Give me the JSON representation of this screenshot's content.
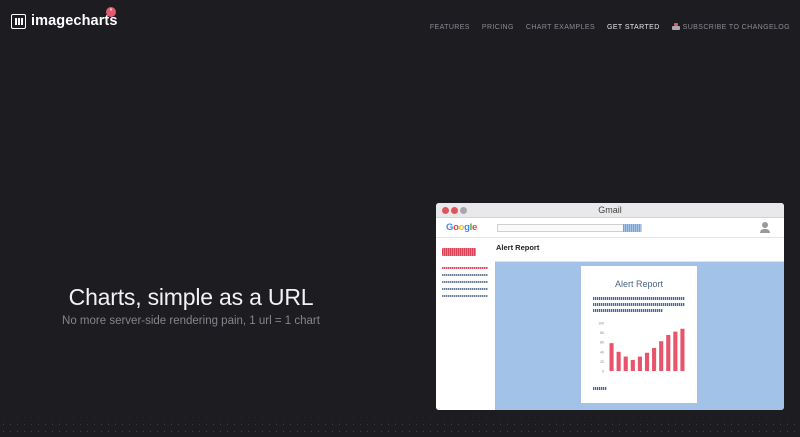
{
  "brand": {
    "name": "imagecharts",
    "badge": "*"
  },
  "nav": {
    "items": [
      {
        "label": "FEATURES",
        "active": false
      },
      {
        "label": "PRICING",
        "active": false
      },
      {
        "label": "CHART EXAMPLES",
        "active": false
      },
      {
        "label": "GET STARTED",
        "active": true
      }
    ],
    "subscribe_label": "SUBSCRIBE TO CHANGELOG"
  },
  "hero": {
    "title": "Charts, simple as a URL",
    "subtitle": "No more server-side rendering pain, 1 url = 1 chart"
  },
  "mock": {
    "window_title": "Gmail",
    "google_logo_letters": [
      "G",
      "o",
      "o",
      "g",
      "l",
      "e"
    ],
    "google_colors": [
      "#4285f4",
      "#ea4335",
      "#fbbc05",
      "#4285f4",
      "#34a853",
      "#ea4335"
    ],
    "subject": "Alert Report",
    "card_title": "Alert Report",
    "chart_data": {
      "type": "bar",
      "ylim": [
        0,
        100
      ],
      "yticks": [
        "100",
        "80",
        "60",
        "40",
        "20",
        "0"
      ],
      "values": [
        58,
        40,
        30,
        23,
        30,
        38,
        48,
        62,
        75,
        82,
        88
      ],
      "color": "#e8546c"
    }
  },
  "colors": {
    "background": "#1d1c21",
    "accent": "#e2596b",
    "mail_body": "#a3c2e8"
  }
}
